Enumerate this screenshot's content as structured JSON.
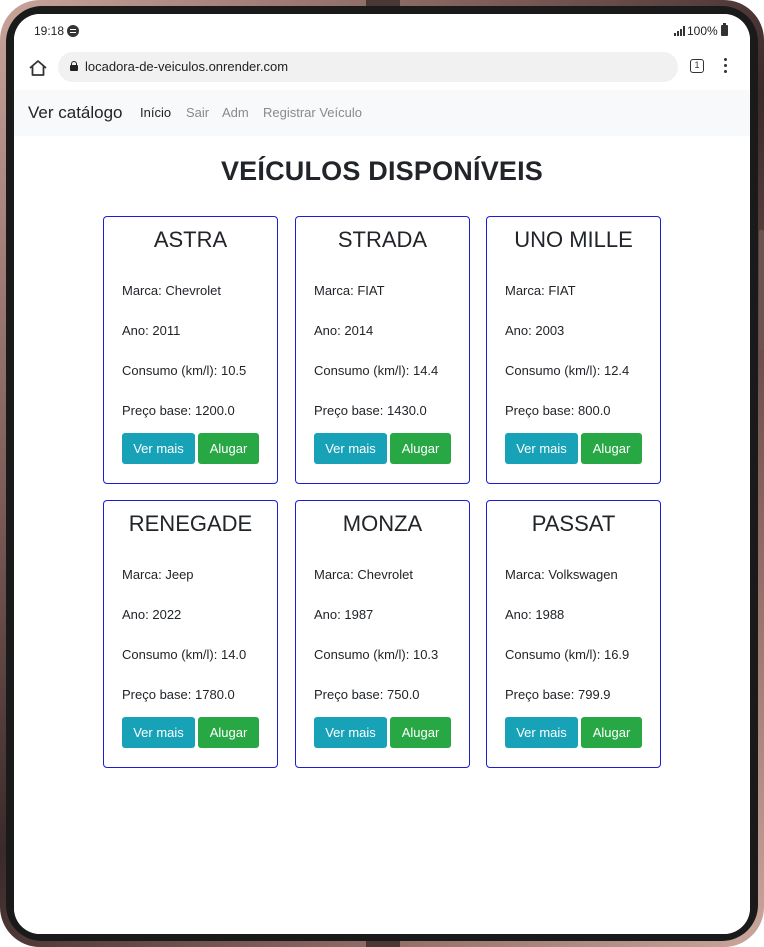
{
  "status_bar": {
    "time": "19:18",
    "battery": "100%"
  },
  "browser": {
    "url": "locadora-de-veiculos.onrender.com",
    "tab_count": "1"
  },
  "navbar": {
    "brand": "Ver catálogo",
    "links": [
      "Início",
      "Sair",
      "Adm",
      "Registrar Veículo"
    ]
  },
  "page_title": "VEÍCULOS DISPONÍVEIS",
  "labels": {
    "marca": "Marca: ",
    "ano": "Ano: ",
    "consumo": "Consumo (km/l): ",
    "preco": "Preço base: ",
    "ver_mais": "Ver mais",
    "alugar": "Alugar"
  },
  "vehicles": [
    {
      "name": "ASTRA",
      "marca": "Chevrolet",
      "ano": "2011",
      "consumo": "10.5",
      "preco": "1200.0"
    },
    {
      "name": "STRADA",
      "marca": "FIAT",
      "ano": "2014",
      "consumo": "14.4",
      "preco": "1430.0"
    },
    {
      "name": "UNO MILLE",
      "marca": "FIAT",
      "ano": "2003",
      "consumo": "12.4",
      "preco": "800.0"
    },
    {
      "name": "RENEGADE",
      "marca": "Jeep",
      "ano": "2022",
      "consumo": "14.0",
      "preco": "1780.0"
    },
    {
      "name": "MONZA",
      "marca": "Chevrolet",
      "ano": "1987",
      "consumo": "10.3",
      "preco": "750.0"
    },
    {
      "name": "PASSAT",
      "marca": "Volkswagen",
      "ano": "1988",
      "consumo": "16.9",
      "preco": "799.9"
    }
  ]
}
